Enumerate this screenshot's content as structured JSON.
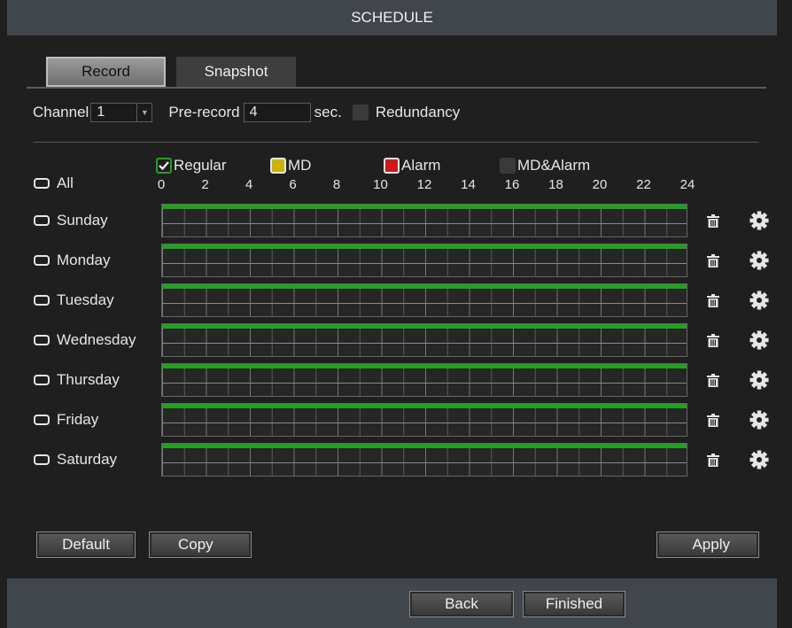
{
  "title": "SCHEDULE",
  "tabs": [
    {
      "label": "Record",
      "active": true
    },
    {
      "label": "Snapshot",
      "active": false
    }
  ],
  "channel": {
    "label": "Channel",
    "value": "1"
  },
  "prerecord": {
    "label": "Pre-record",
    "value": "4",
    "unit": "sec."
  },
  "redundancy": {
    "label": "Redundancy",
    "checked": false
  },
  "legend": [
    {
      "label": "Regular",
      "color": "#1fa31f",
      "checked": true
    },
    {
      "label": "MD",
      "color": "#c8b400",
      "checked": false
    },
    {
      "label": "Alarm",
      "color": "#d01818",
      "checked": false
    },
    {
      "label": "MD&Alarm",
      "color": "#3a3a3a",
      "checked": false
    }
  ],
  "all_label": "All",
  "hours": [
    "0",
    "2",
    "4",
    "6",
    "8",
    "10",
    "12",
    "14",
    "16",
    "18",
    "20",
    "22",
    "24"
  ],
  "days": [
    {
      "label": "Sunday",
      "segment": [
        0,
        24
      ]
    },
    {
      "label": "Monday",
      "segment": [
        0,
        24
      ]
    },
    {
      "label": "Tuesday",
      "segment": [
        0,
        24
      ]
    },
    {
      "label": "Wednesday",
      "segment": [
        0,
        24
      ]
    },
    {
      "label": "Thursday",
      "segment": [
        0,
        24
      ]
    },
    {
      "label": "Friday",
      "segment": [
        0,
        24
      ]
    },
    {
      "label": "Saturday",
      "segment": [
        0,
        24
      ]
    }
  ],
  "buttons": {
    "default": "Default",
    "copy": "Copy",
    "apply": "Apply",
    "back": "Back",
    "finished": "Finished"
  },
  "colors": {
    "regular": "#1fa31f",
    "titlebar": "#40464b",
    "background": "#1f1f1f"
  }
}
